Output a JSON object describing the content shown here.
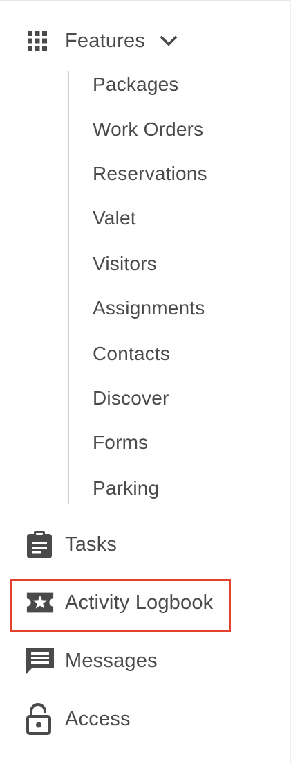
{
  "nav": {
    "features": {
      "label": "Features",
      "icon": "apps-grid-icon",
      "expanded": true,
      "submenu": [
        "Packages",
        "Work Orders",
        "Reservations",
        "Valet",
        "Visitors",
        "Assignments",
        "Contacts",
        "Discover",
        "Forms",
        "Parking"
      ]
    },
    "tasks": {
      "label": "Tasks",
      "icon": "clipboard-icon"
    },
    "activity_logbook": {
      "label": "Activity Logbook",
      "icon": "star-ticket-icon",
      "highlighted": true,
      "highlight_color": "#e1412d"
    },
    "messages": {
      "label": "Messages",
      "icon": "message-icon"
    },
    "access": {
      "label": "Access",
      "icon": "lock-open-icon"
    }
  },
  "colors": {
    "text": "#4a4a4a",
    "icon": "#4a4a4a",
    "divider": "#cfcfcf",
    "highlight": "#e1412d"
  }
}
